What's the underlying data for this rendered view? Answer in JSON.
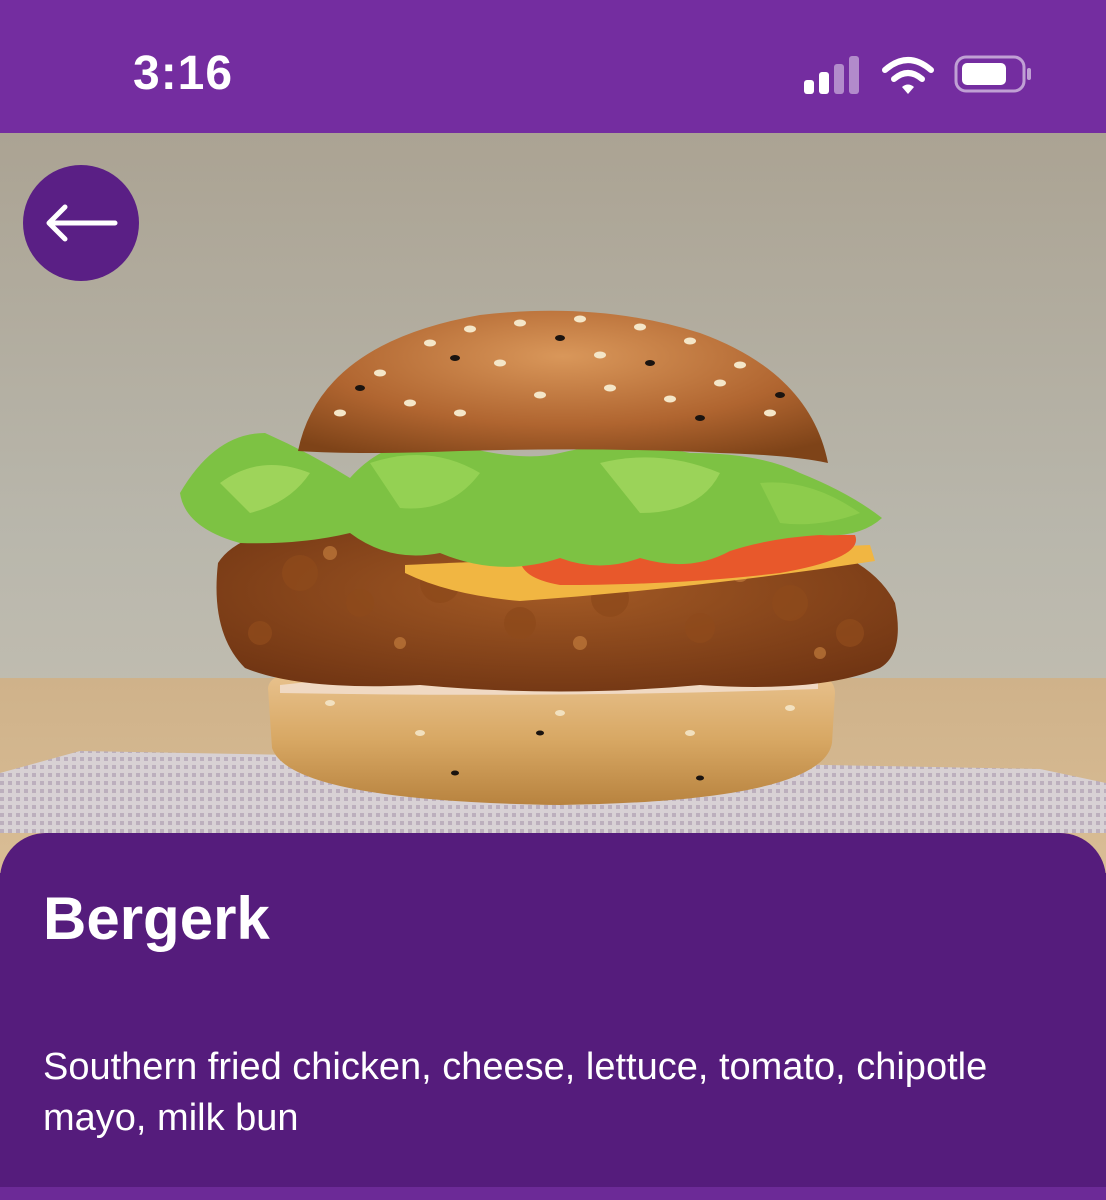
{
  "status_bar": {
    "time": "3:16",
    "signal_icon": "cellular-signal-icon",
    "wifi_icon": "wifi-icon",
    "battery_icon": "battery-icon"
  },
  "hero": {
    "image": "fried-chicken-burger-photo"
  },
  "navigation": {
    "back_icon": "arrow-left-icon"
  },
  "item": {
    "name": "Bergerk",
    "description": "Southern fried chicken, cheese, lettuce, tomato, chipotle mayo, milk bun"
  },
  "colors": {
    "status_bar": "#742DA0",
    "card": "#551C7C",
    "back_button": "#5A1F85",
    "text": "#FFFFFF"
  }
}
